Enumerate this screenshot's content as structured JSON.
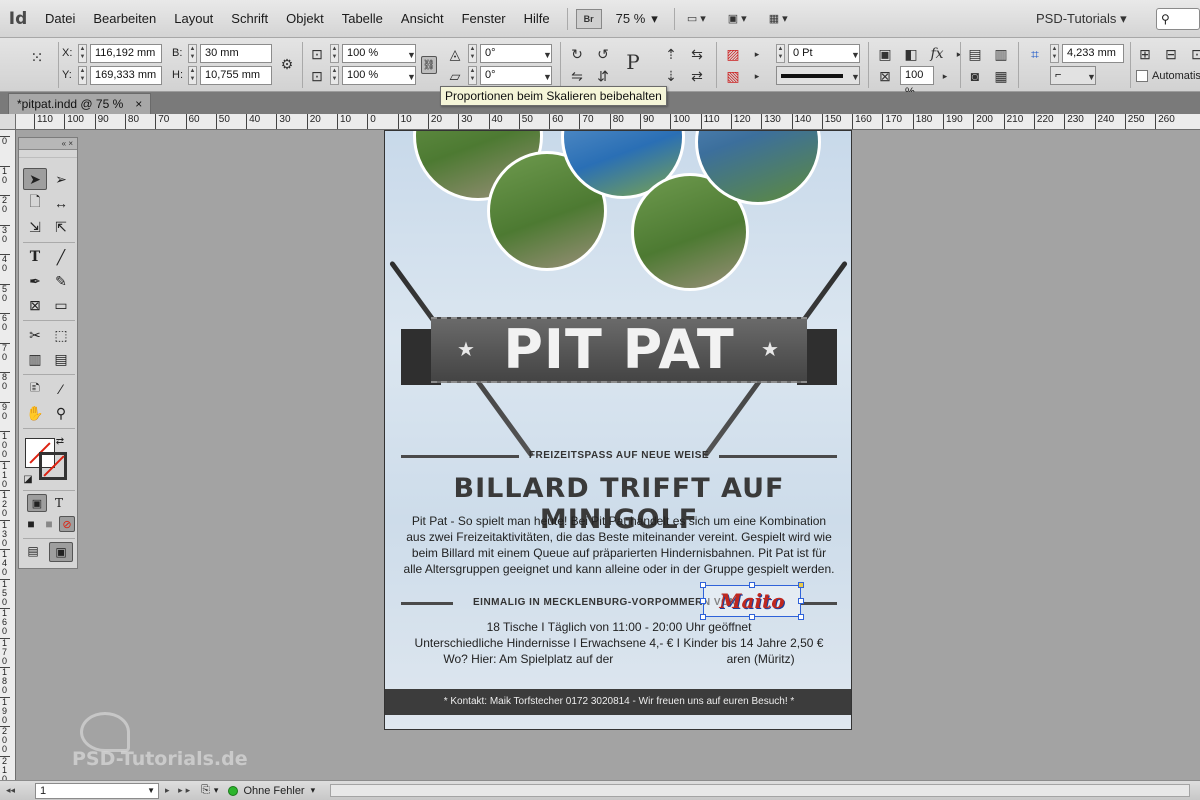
{
  "app": {
    "logo": "Id",
    "menu": [
      "Datei",
      "Bearbeiten",
      "Layout",
      "Schrift",
      "Objekt",
      "Tabelle",
      "Ansicht",
      "Fenster",
      "Hilfe"
    ],
    "bridge_label": "Br",
    "zoom": "75 %",
    "workspace": "PSD-Tutorials"
  },
  "control": {
    "x_label": "X:",
    "x_value": "116,192 mm",
    "y_label": "Y:",
    "y_value": "169,333 mm",
    "w_label": "B:",
    "w_value": "30 mm",
    "h_label": "H:",
    "h_value": "10,755 mm",
    "scale_x": "100 %",
    "scale_y": "100 %",
    "rotate": "0°",
    "shear": "0°",
    "stroke_weight": "0 Pt",
    "opacity": "100 %",
    "offset": "4,233 mm",
    "autofit_label": "Automatisch"
  },
  "tooltip": "Proportionen beim Skalieren beibehalten",
  "document": {
    "tab": "*pitpat.indd @ 75 %"
  },
  "ruler": {
    "h_labels": [
      "110",
      "100",
      "90",
      "80",
      "70",
      "60",
      "50",
      "40",
      "30",
      "20",
      "10",
      "0",
      "10",
      "20",
      "30",
      "40",
      "50",
      "60",
      "70",
      "80",
      "90",
      "100",
      "110",
      "120",
      "130",
      "140",
      "150",
      "160",
      "170",
      "180",
      "190",
      "200",
      "210",
      "220",
      "230",
      "240",
      "250",
      "260"
    ],
    "v_labels": [
      "0",
      "1 0",
      "2 0",
      "3 0",
      "4 0",
      "5 0",
      "6 0",
      "7 0",
      "8 0",
      "9 0",
      "1 0 0",
      "1 1 0",
      "1 2 0",
      "1 3 0",
      "1 4 0",
      "1 5 0",
      "1 6 0",
      "1 7 0",
      "1 8 0",
      "1 9 0",
      "2 0 0",
      "2 1 0",
      "2 2 0"
    ]
  },
  "flyer": {
    "title": "PIT PAT",
    "tagline": "FREIZEITSPASS AUF NEUE WEISE",
    "headline": "BILLARD TRIFFT AUF MINIGOLF",
    "body": "Pit Pat - So spielt man heute! Bei Pit Pat handelt es sich um eine Kombination aus zwei Freizeitaktivitäten, die das Beste miteinander vereint. Gespielt wird wie beim Billard mit einem Queue auf präparierten Hindernisbahnen. Pit Pat ist für alle Altersgruppen geeignet und kann alleine oder in der Gruppe gespielt werden.",
    "sub2": "EINMALIG IN MECKLENBURG-VORPOMMERN VON",
    "logo": "Maito",
    "info1": "18 Tische I Täglich von 11:00 - 20:00 Uhr geöffnet",
    "info2": "Unterschiedliche Hindernisse I Erwachsene 4,- € I Kinder bis 14 Jahre 2,50 €",
    "info3": "Wo? Hier: Am Spielplatz auf der                                  aren (Müritz)",
    "footer": "* Kontakt: Maik Torfstecher 0172 3020814 - Wir freuen uns auf euren Besuch! *"
  },
  "status": {
    "page": "1",
    "preflight": "Ohne Fehler"
  },
  "watermark": "PSD-Tutorials.de"
}
